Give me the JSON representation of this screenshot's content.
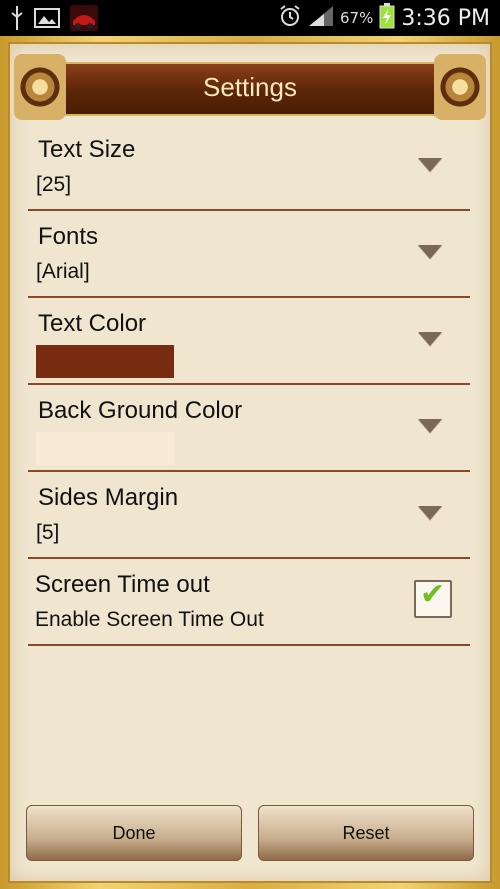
{
  "status_bar": {
    "time": "3:36 PM",
    "battery_percent": "67%",
    "icons": [
      "usb-icon",
      "image-icon",
      "app-thumbnail-icon",
      "alarm-icon",
      "signal-icon",
      "battery-charging-icon"
    ]
  },
  "header": {
    "title": "Settings"
  },
  "settings": {
    "text_size": {
      "title": "Text Size",
      "value": "[25]"
    },
    "fonts": {
      "title": "Fonts",
      "value": "[Arial]"
    },
    "text_color": {
      "title": "Text Color",
      "swatch_color": "#772b10"
    },
    "background_color": {
      "title": "Back Ground Color",
      "swatch_color": "#f7ebd6"
    },
    "sides_margin": {
      "title": "Sides Margin",
      "value": "[5]"
    },
    "screen_timeout": {
      "title": "Screen Time out",
      "description": "Enable Screen Time Out",
      "checked": true
    }
  },
  "buttons": {
    "done": "Done",
    "reset": "Reset"
  },
  "colors": {
    "accent_dark": "#5b2508",
    "accent_gold": "#d9b25b",
    "paper": "#f0e6d0"
  }
}
